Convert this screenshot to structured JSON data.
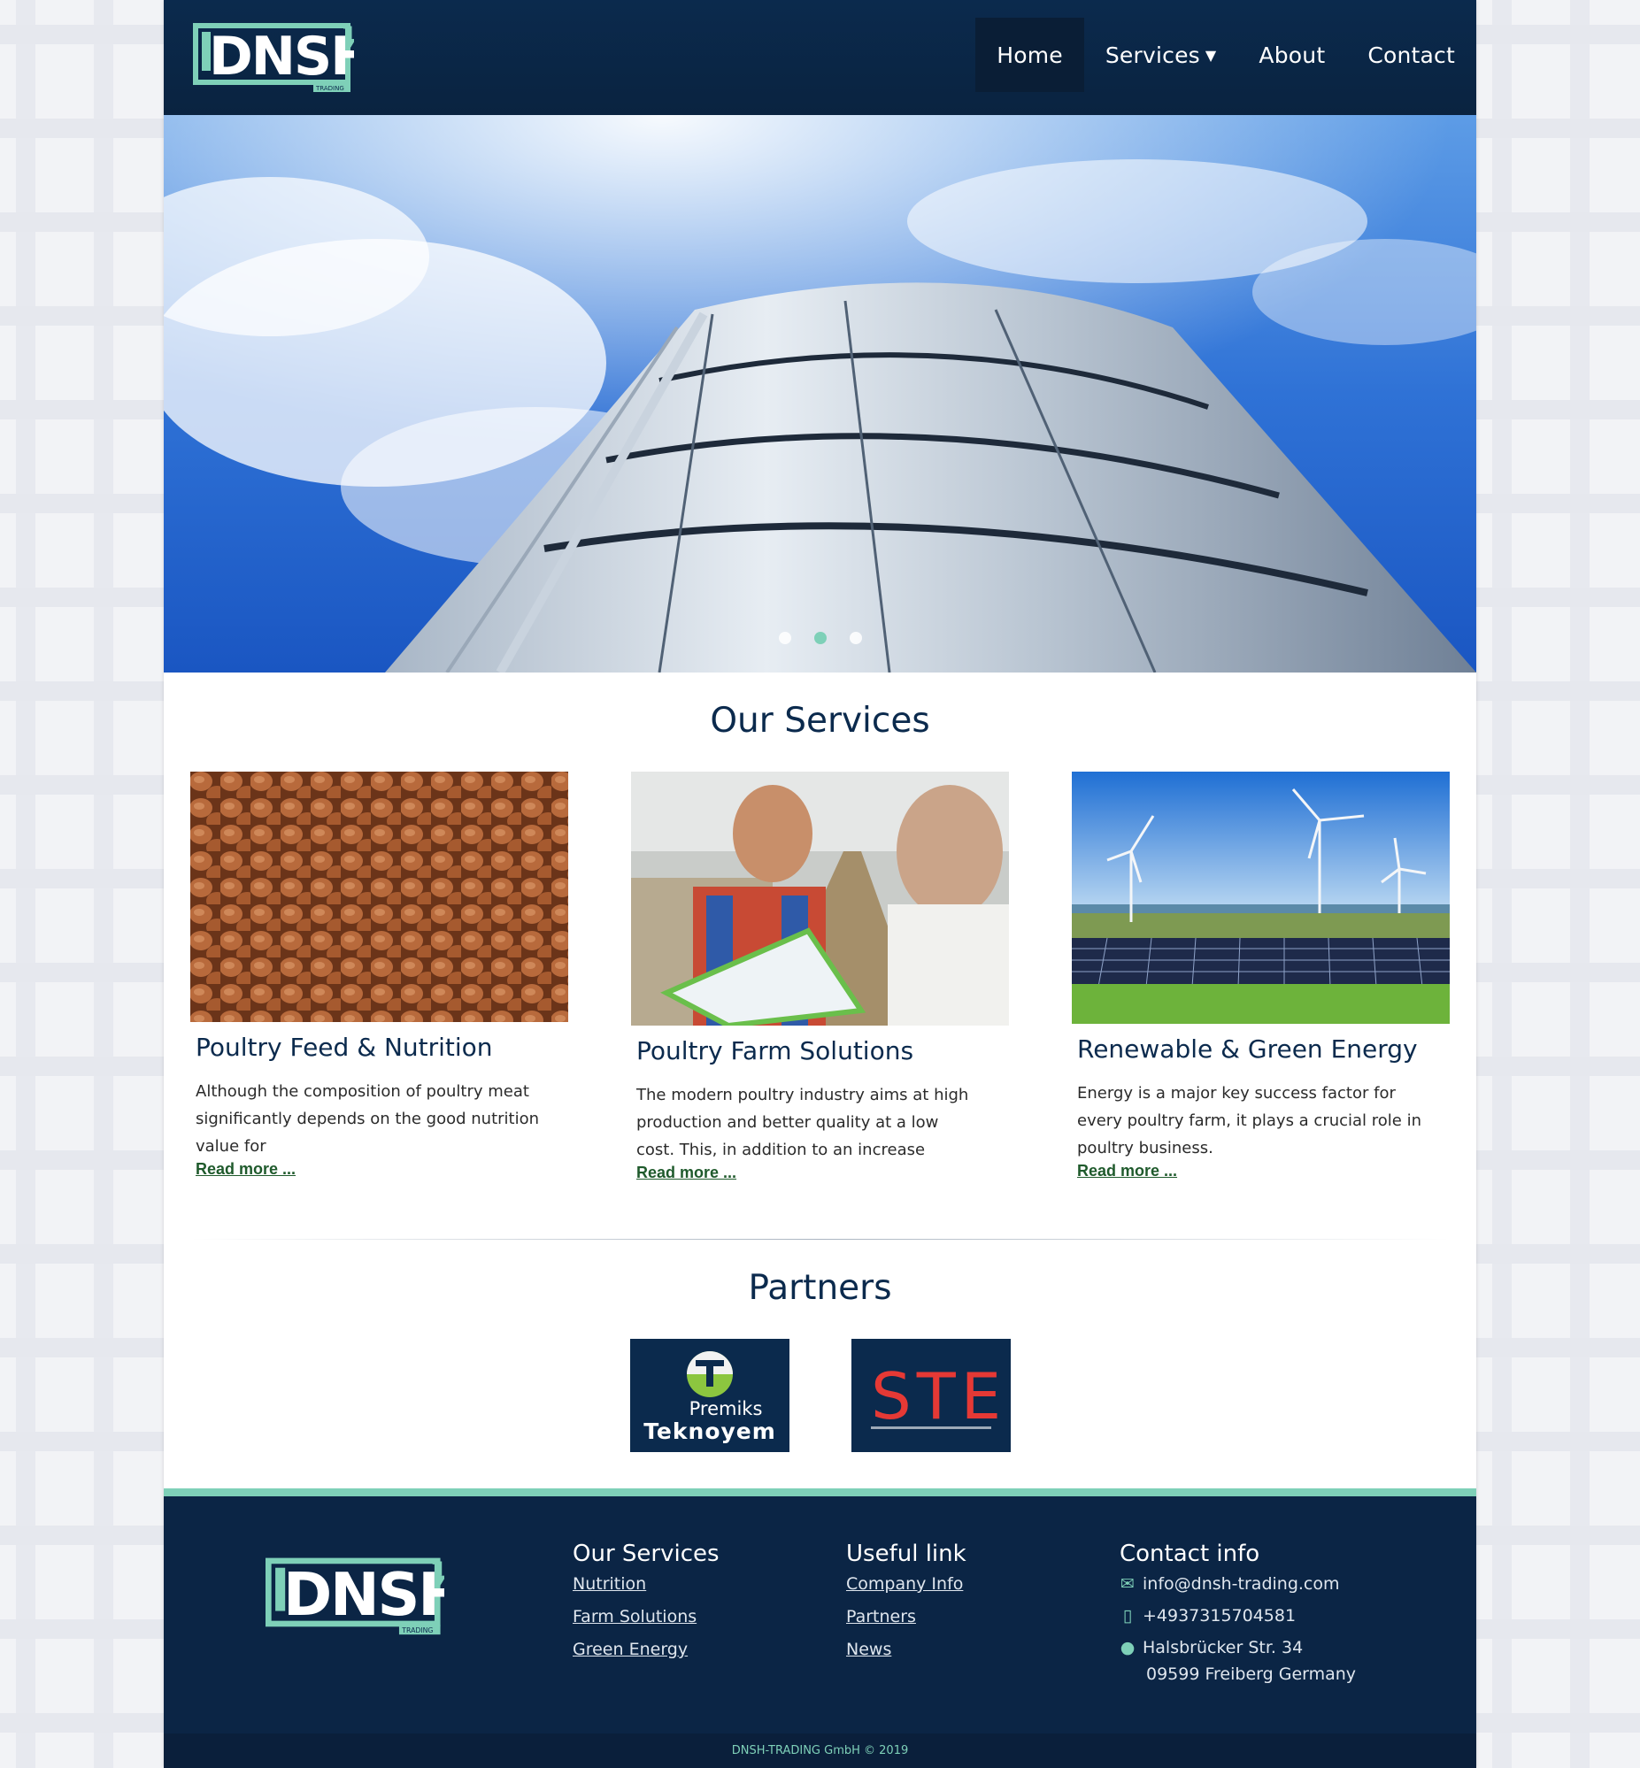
{
  "brand": {
    "logo_text": "DNSH",
    "logo_subtext": "TRADING"
  },
  "nav": {
    "items": [
      {
        "label": "Home",
        "active": true
      },
      {
        "label": "Services",
        "dropdown": true
      },
      {
        "label": "About"
      },
      {
        "label": "Contact"
      }
    ]
  },
  "hero": {
    "slide_count": 3,
    "active_slide": 2
  },
  "services": {
    "title": "Our Services",
    "cards": [
      {
        "title": "Poultry Feed & Nutrition",
        "text": "Although the composition of poultry meat significantly depends on the good nutrition value for",
        "link": "Read more ..."
      },
      {
        "title": "Poultry Farm Solutions",
        "text": "The modern poultry industry aims at high production and better quality at a low cost. This, in addition to an increase",
        "link": "Read more ..."
      },
      {
        "title": "Renewable & Green Energy",
        "text": "Energy is a major key success factor for every poultry farm, it plays a crucial role in poultry business.",
        "link": "Read more ..."
      }
    ]
  },
  "partners": {
    "title": "Partners",
    "items": [
      {
        "line1": "Premiks",
        "line2": "Teknoyem"
      },
      {
        "logo_text": "STE"
      }
    ]
  },
  "footer": {
    "services": {
      "title": "Our Services",
      "links": [
        "Nutrition",
        "Farm Solutions",
        "Green Energy"
      ]
    },
    "useful": {
      "title": "Useful link",
      "links": [
        "Company Info",
        "Partners",
        "News"
      ]
    },
    "contact": {
      "title": "Contact info",
      "email": "info@dnsh-trading.com",
      "phone": "+4937315704581",
      "address_line1": "Halsbrücker Str. 34",
      "address_line2": "09599 Freiberg Germany"
    },
    "copyright": "DNSH-TRADING GmbH © 2019"
  },
  "colors": {
    "navy": "#0b2a4d",
    "mint": "#7ed0b8",
    "link_green": "#1f5a2c"
  }
}
